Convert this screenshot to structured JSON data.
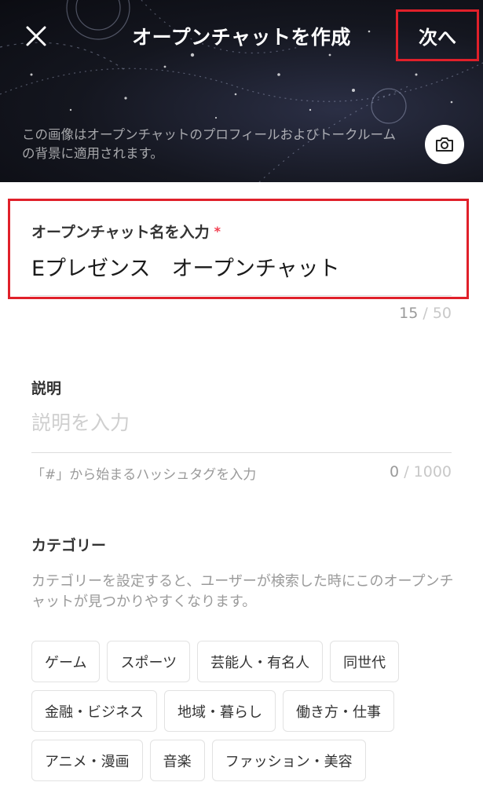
{
  "header": {
    "title": "オープンチャットを作成",
    "next_label": "次へ",
    "background_note": "この画像はオープンチャットのプロフィールおよびトークルームの背景に適用されます。",
    "icons": {
      "close": "close-icon",
      "camera": "camera-icon"
    }
  },
  "name": {
    "label": "オープンチャット名を入力",
    "required_mark": "*",
    "value": "Eプレゼンス　オープンチャット",
    "count": "15",
    "separator": "/",
    "max": "50"
  },
  "description": {
    "label": "説明",
    "placeholder": "説明を入力",
    "hashtag_hint": "「#」から始まるハッシュタグを入力",
    "count": "0",
    "separator": "/",
    "max": "1000"
  },
  "category": {
    "label": "カテゴリー",
    "description": "カテゴリーを設定すると、ユーザーが検索した時にこのオープンチャットが見つかりやすくなります。",
    "rows": [
      [
        "ゲーム",
        "スポーツ",
        "芸能人・有名人",
        "同世代"
      ],
      [
        "金融・ビジネス",
        "地域・暮らし",
        "働き方・仕事"
      ],
      [
        "アニメ・漫画",
        "音楽",
        "ファッション・美容"
      ]
    ]
  },
  "colors": {
    "highlight": "#e0202a",
    "required": "#f23d4f"
  }
}
